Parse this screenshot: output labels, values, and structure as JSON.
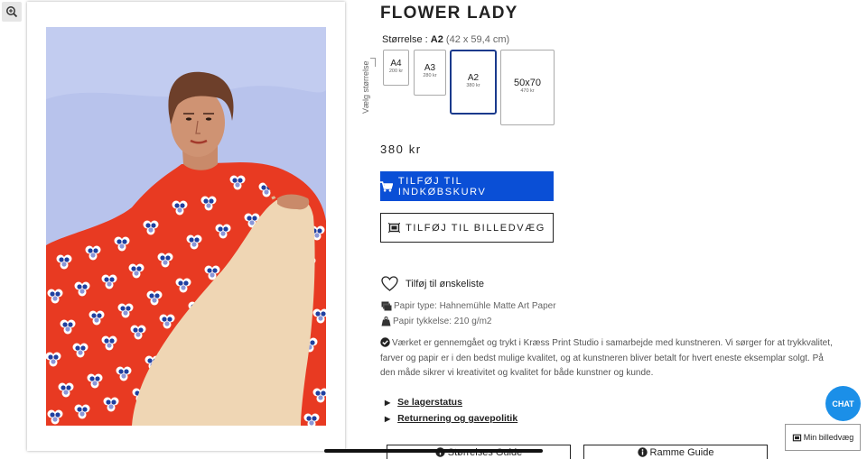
{
  "product": {
    "title": "FLOWER LADY",
    "size_label": "Størrelse :",
    "selected_size": "A2",
    "selected_dimensions": "(42 x 59,4 cm)",
    "size_picker_label": "Vælg størrelse",
    "sizes": [
      {
        "name": "A4",
        "price": "200 kr"
      },
      {
        "name": "A3",
        "price": "280 kr"
      },
      {
        "name": "A2",
        "price": "380 kr"
      },
      {
        "name": "50x70",
        "price": "470 kr"
      }
    ],
    "price": "380 kr",
    "add_to_cart_label": "TILFØJ TIL INDKØBSKURV",
    "add_to_wall_label": "TILFØJ TIL BILLEDVÆG",
    "wishlist_label": "Tilføj til ønskeliste",
    "paper_type": "Papir type: Hahnemühle Matte Art Paper",
    "paper_thickness": "Papir tykkelse: 210 g/m2",
    "description": "Værket er gennemgået og trykt i Kræss Print Studio i samarbejde med kunstneren. Vi sørger for at trykkvalitet, farver og papir er i den bedst mulige kvalitet, og at kunstneren bliver betalt for hvert eneste eksemplar solgt. På den måde sikrer vi kreativitet og kvalitet for både kunstner og kunde.",
    "stock_link": "Se lagerstatus",
    "returns_link": "Returnering og gavepolitik",
    "size_guide_label": "Størrelses Guide",
    "frame_guide_label": "Ramme Guide"
  },
  "widgets": {
    "chat_label": "CHAT",
    "my_wall_label": "Min billedvæg"
  },
  "colors": {
    "accent_blue": "#0a4fd6",
    "selected_border": "#1a3a8c",
    "chat_blue": "#1b8fe8"
  },
  "icons": [
    "zoom-in-icon",
    "cart-icon",
    "picture-wall-icon",
    "heart-icon",
    "paper-stack-icon",
    "weight-icon",
    "check-circle-icon",
    "info-icon",
    "chevron-right-icon"
  ]
}
